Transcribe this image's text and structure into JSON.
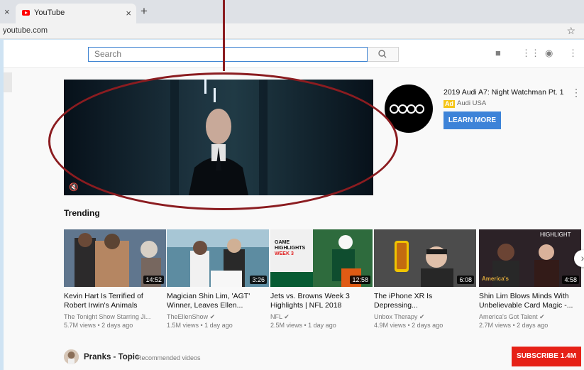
{
  "browser": {
    "left_close": "×",
    "tab": {
      "title": "YouTube",
      "close": "×"
    },
    "new_tab": "+",
    "url": "youtube.com",
    "star": "☆"
  },
  "topbar": {
    "search_placeholder": "Search",
    "search_icon": "magnifier-icon",
    "icons": [
      "video-camera-icon",
      "apps-grid-icon",
      "messages-icon",
      "more-vertical-icon"
    ]
  },
  "ad": {
    "title": "2019 Audi A7: Night Watchman Pt. 1",
    "badge": "Ad",
    "channel": "Audi USA",
    "cta": "LEARN MORE"
  },
  "trending": {
    "title": "Trending",
    "videos": [
      {
        "title": "Kevin Hart Is Terrified of Robert Irwin's Animals",
        "channel": "The Tonight Show Starring Ji...",
        "meta": "5.7M views • 2 days ago",
        "duration": "14:52",
        "verified": false,
        "thumb_color": "#5c6f86"
      },
      {
        "title": "Magician Shin Lim, 'AGT' Winner, Leaves Ellen...",
        "channel": "TheEllenShow",
        "meta": "1.5M views • 1 day ago",
        "duration": "3:26",
        "verified": true,
        "thumb_color": "#4f8aa6"
      },
      {
        "title": "Jets vs. Browns Week 3 Highlights | NFL 2018",
        "channel": "NFL",
        "meta": "2.5M views • 1 day ago",
        "duration": "12:58",
        "verified": true,
        "thumb_color": "#2f6d3c",
        "overlay": "GAME HIGHLIGHTS WEEK 3"
      },
      {
        "title": "The iPhone XR Is Depressing...",
        "channel": "Unbox Therapy",
        "meta": "4.9M views • 2 days ago",
        "duration": "6:08",
        "verified": true,
        "thumb_color": "#4c4c4c"
      },
      {
        "title": "Shin Lim Blows Minds With Unbelievable Card Magic -...",
        "channel": "America's Got Talent",
        "meta": "2.7M views • 2 days ago",
        "duration": "4:58",
        "verified": true,
        "thumb_color": "#35272a",
        "overlay": "HIGHLIGHT"
      }
    ]
  },
  "recommended": {
    "channel": "Pranks - Topic",
    "subtitle": "Recommended videos",
    "subscribe_label": "SUBSCRIBE",
    "subscribe_count": "1.4M"
  },
  "colors": {
    "annotation": "#8b1c20",
    "youtube_red": "#ff0000",
    "link_blue": "#3d83d8"
  }
}
